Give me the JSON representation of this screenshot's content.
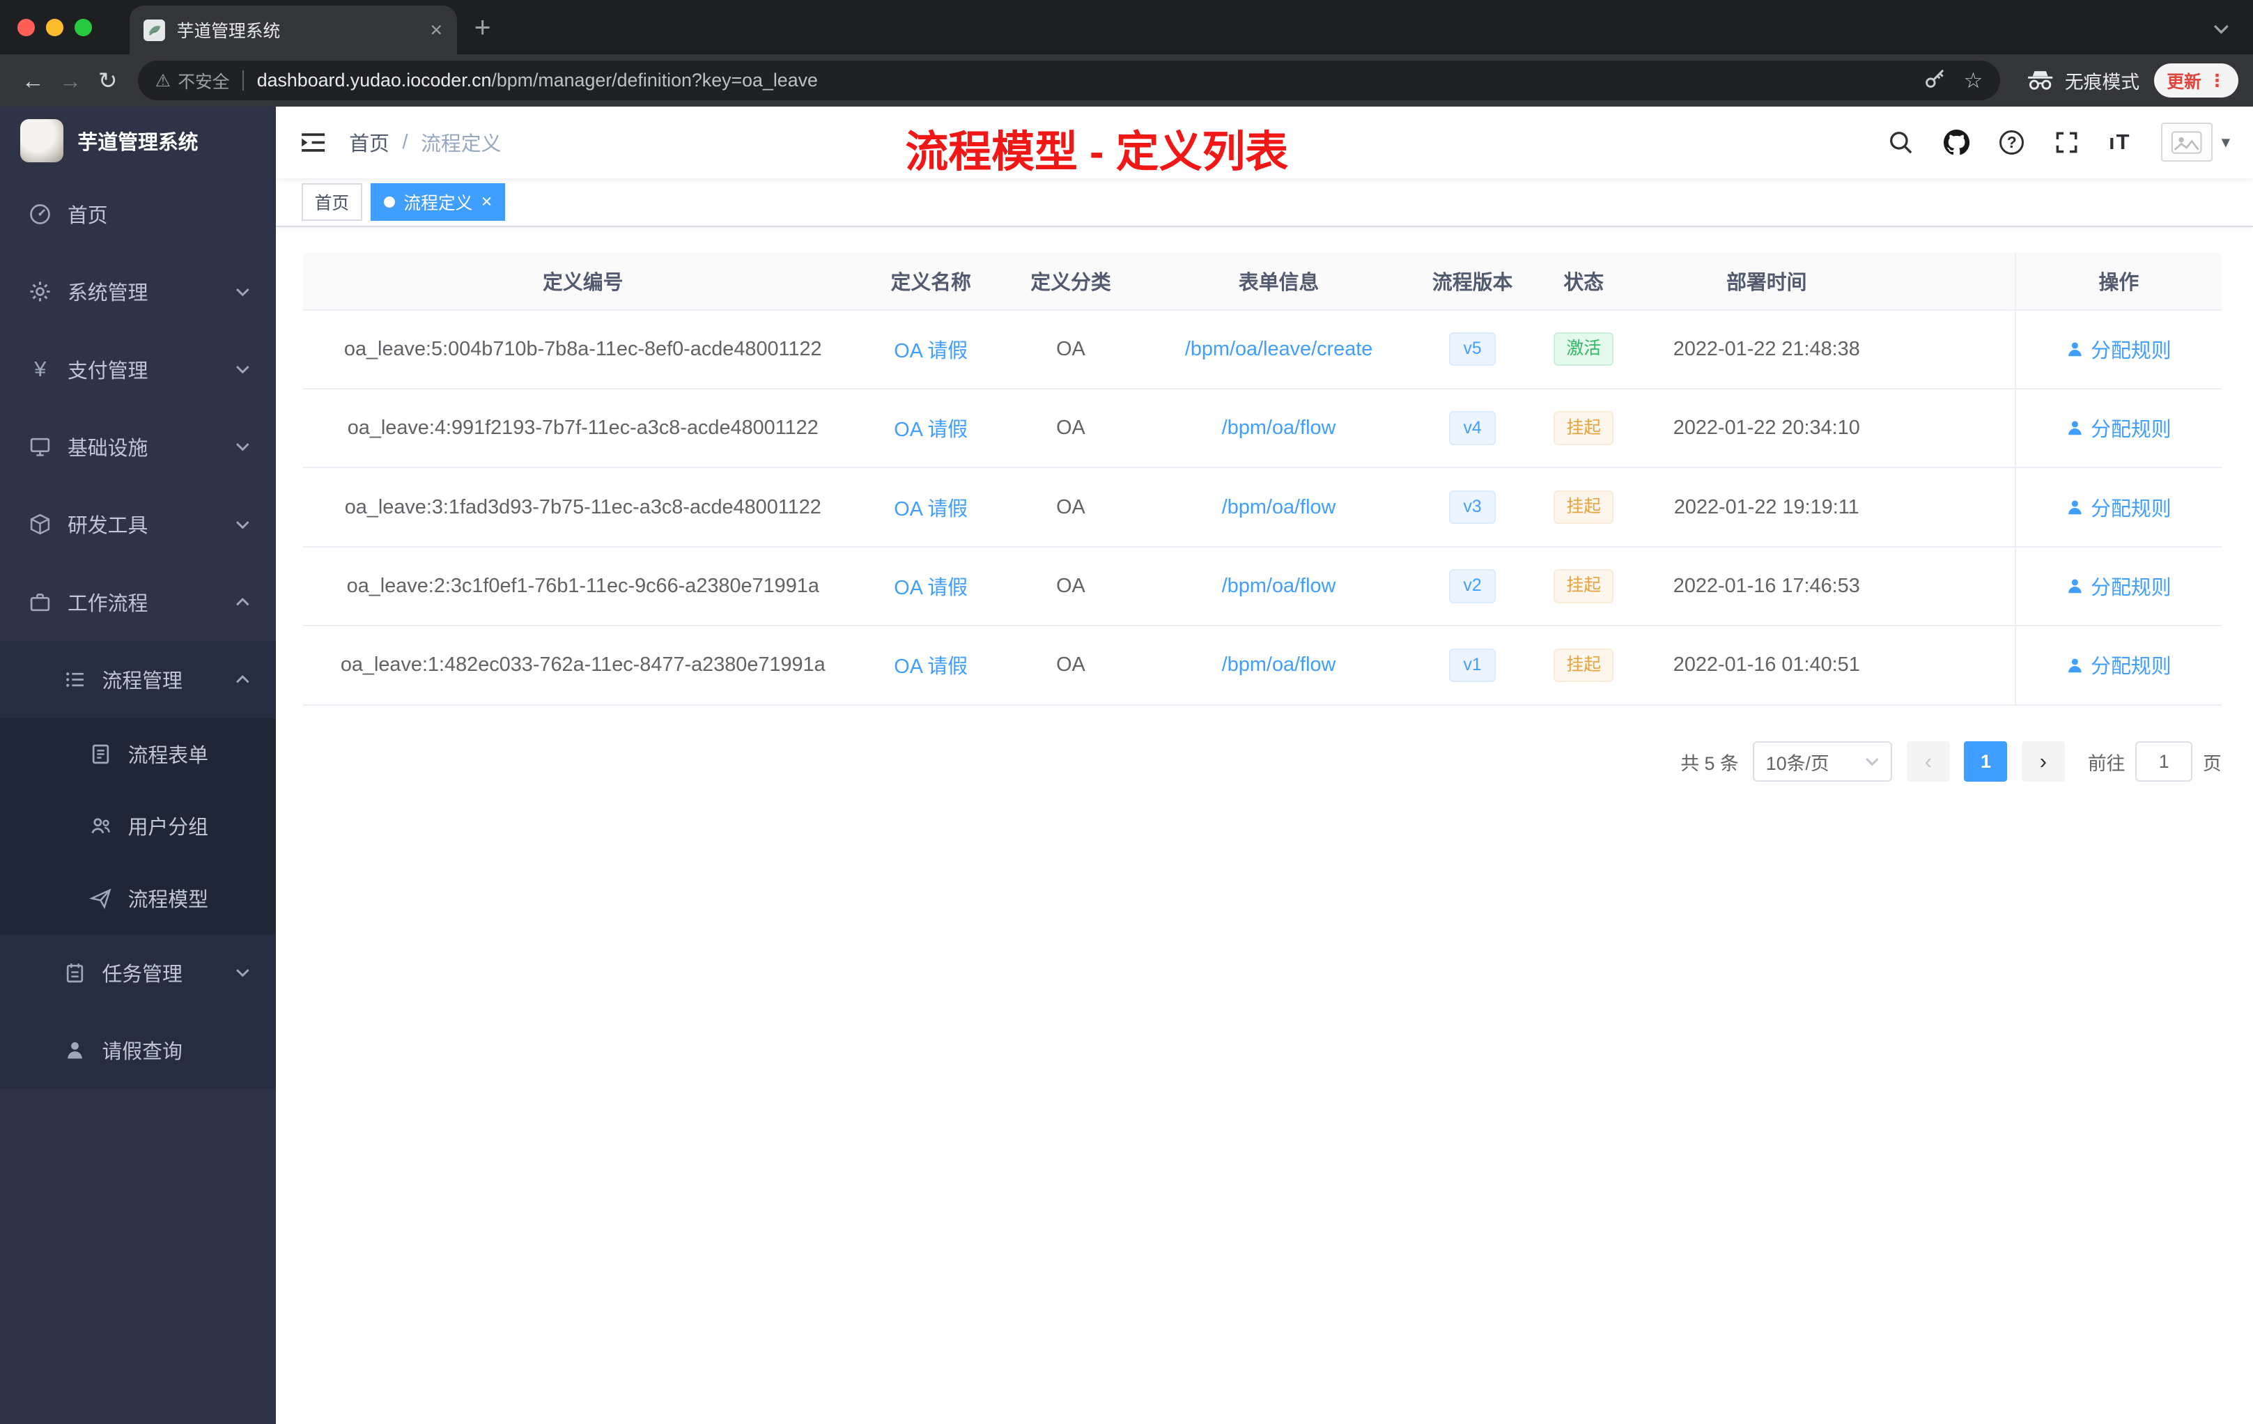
{
  "chrome": {
    "tab_title": "芋道管理系统",
    "security_chip": "不安全",
    "url_host": "dashboard.yudao.iocoder.cn",
    "url_path": "/bpm/manager/definition?key=oa_leave",
    "incognito_label": "无痕模式",
    "update_label": "更新"
  },
  "icons": {
    "close_tab": "×",
    "new_tab": "+",
    "back": "←",
    "forward": "→",
    "reload": "↻",
    "warning": "⚠",
    "star": "☆",
    "yen": "¥",
    "question": "?",
    "caret_down": "▾",
    "prev": "‹",
    "next": "›",
    "font_size": "ıT",
    "tag_close": "×",
    "overflow_dots": "⋮"
  },
  "sidebar": {
    "logo_title": "芋道管理系统",
    "items": [
      {
        "label": "首页"
      },
      {
        "label": "系统管理"
      },
      {
        "label": "支付管理"
      },
      {
        "label": "基础设施"
      },
      {
        "label": "研发工具"
      },
      {
        "label": "工作流程"
      },
      {
        "label": "流程管理"
      },
      {
        "label": "流程表单"
      },
      {
        "label": "用户分组"
      },
      {
        "label": "流程模型"
      },
      {
        "label": "任务管理"
      },
      {
        "label": "请假查询"
      }
    ]
  },
  "header": {
    "breadcrumb_home": "首页",
    "breadcrumb_sep": "/",
    "breadcrumb_current": "流程定义",
    "annotation": "流程模型 - 定义列表"
  },
  "tags": {
    "home": "首页",
    "active": "流程定义"
  },
  "table": {
    "columns": {
      "id": "定义编号",
      "name": "定义名称",
      "category": "定义分类",
      "form": "表单信息",
      "version": "流程版本",
      "status": "状态",
      "deploy_time": "部署时间",
      "actions": "操作"
    },
    "rows": [
      {
        "id": "oa_leave:5:004b710b-7b8a-11ec-8ef0-acde48001122",
        "name": "OA 请假",
        "category": "OA",
        "form": "/bpm/oa/leave/create",
        "version": "v5",
        "status": {
          "label": "激活",
          "type": "success"
        },
        "deploy_time": "2022-01-22 21:48:38",
        "action": "分配规则"
      },
      {
        "id": "oa_leave:4:991f2193-7b7f-11ec-a3c8-acde48001122",
        "name": "OA 请假",
        "category": "OA",
        "form": "/bpm/oa/flow",
        "version": "v4",
        "status": {
          "label": "挂起",
          "type": "warning"
        },
        "deploy_time": "2022-01-22 20:34:10",
        "action": "分配规则"
      },
      {
        "id": "oa_leave:3:1fad3d93-7b75-11ec-a3c8-acde48001122",
        "name": "OA 请假",
        "category": "OA",
        "form": "/bpm/oa/flow",
        "version": "v3",
        "status": {
          "label": "挂起",
          "type": "warning"
        },
        "deploy_time": "2022-01-22 19:19:11",
        "action": "分配规则"
      },
      {
        "id": "oa_leave:2:3c1f0ef1-76b1-11ec-9c66-a2380e71991a",
        "name": "OA 请假",
        "category": "OA",
        "form": "/bpm/oa/flow",
        "version": "v2",
        "status": {
          "label": "挂起",
          "type": "warning"
        },
        "deploy_time": "2022-01-16 17:46:53",
        "action": "分配规则"
      },
      {
        "id": "oa_leave:1:482ec033-762a-11ec-8477-a2380e71991a",
        "name": "OA 请假",
        "category": "OA",
        "form": "/bpm/oa/flow",
        "version": "v1",
        "status": {
          "label": "挂起",
          "type": "warning"
        },
        "deploy_time": "2022-01-16 01:40:51",
        "action": "分配规则"
      }
    ]
  },
  "pagination": {
    "total": "共 5 条",
    "page_size": "10条/页",
    "current_page": "1",
    "goto_label": "前往",
    "goto_value": "1",
    "goto_unit": "页"
  },
  "colors": {
    "accent_blue": "#409eff",
    "success_green": "#2fb966",
    "warning_orange": "#e6a23c",
    "annotation_red": "#f11717",
    "sidebar_bg": "#2e3446"
  }
}
